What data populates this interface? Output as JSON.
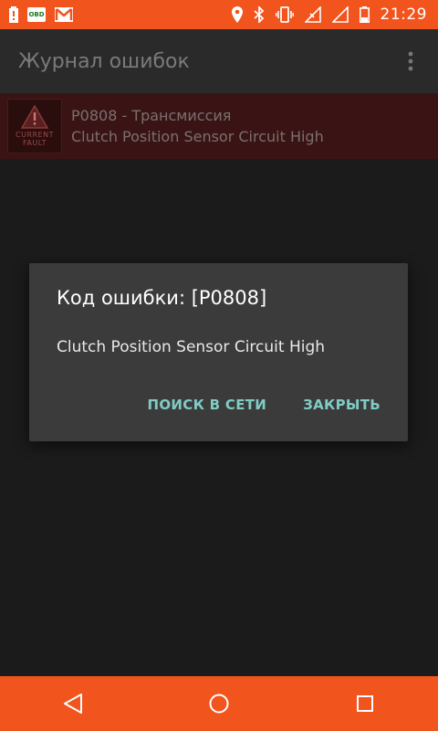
{
  "status_bar": {
    "time": "21:29",
    "obd_badge": "OBD",
    "icons": [
      "battery-alert-icon",
      "obd-icon",
      "gmail-icon",
      "location-icon",
      "bluetooth-icon",
      "vibrate-icon",
      "no-signal-icon",
      "wifi-off-icon",
      "battery-icon"
    ]
  },
  "app_bar": {
    "title": "Журнал ошибок",
    "overflow_icon": "more-vert-icon"
  },
  "list": {
    "items": [
      {
        "thumb_text": "CURRENT FAULT",
        "title": "P0808 - Трансмиссия",
        "subtitle": "Clutch Position Sensor Circuit High"
      }
    ]
  },
  "dialog": {
    "title": "Код ошибки: [P0808]",
    "message": "Clutch Position Sensor Circuit High",
    "search_label": "ПОИСК В СЕТИ",
    "close_label": "ЗАКРЫТЬ"
  },
  "nav_bar": {
    "icons": [
      "back-icon",
      "home-icon",
      "recents-icon"
    ]
  },
  "colors": {
    "accent": "#f2541d",
    "dialog_bg": "#3b3b3b",
    "dialog_button": "#80cbc4"
  }
}
